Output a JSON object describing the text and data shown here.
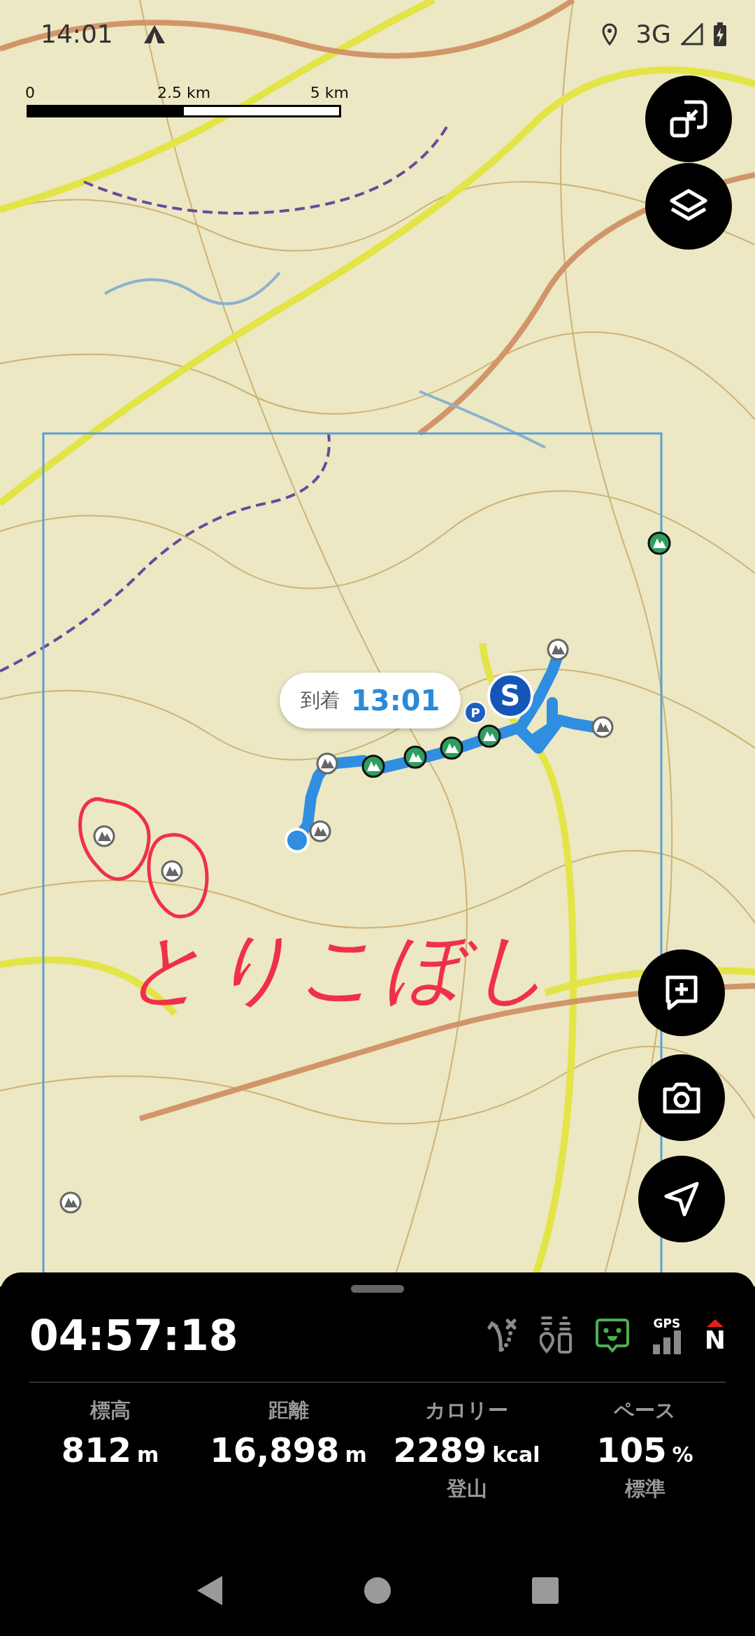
{
  "status_bar": {
    "time": "14:01",
    "network": "3G"
  },
  "scale_bar": {
    "labels": [
      "0",
      "2.5 km",
      "5 km"
    ]
  },
  "map": {
    "callout": {
      "label": "到着",
      "time": "13:01"
    },
    "start_marker": "S",
    "parking_marker": "P",
    "annotation": "とりこぼし"
  },
  "panel": {
    "elapsed": "04:57:18",
    "indicators": [
      {
        "kind": "route",
        "active": false
      },
      {
        "kind": "spots",
        "active": false
      },
      {
        "kind": "assistant",
        "active": true
      },
      {
        "kind": "gps",
        "label": "GPS",
        "active": false
      },
      {
        "kind": "compass",
        "label": "N",
        "active": false
      }
    ],
    "stats": [
      {
        "label": "標高",
        "value": "812",
        "unit": "m"
      },
      {
        "label": "距離",
        "value": "16,898",
        "unit": "m"
      },
      {
        "label": "カロリー",
        "value": "2289",
        "unit": "kcal",
        "sub": "登山"
      },
      {
        "label": "ペース",
        "value": "105",
        "unit": "%",
        "sub": "標準"
      }
    ]
  }
}
